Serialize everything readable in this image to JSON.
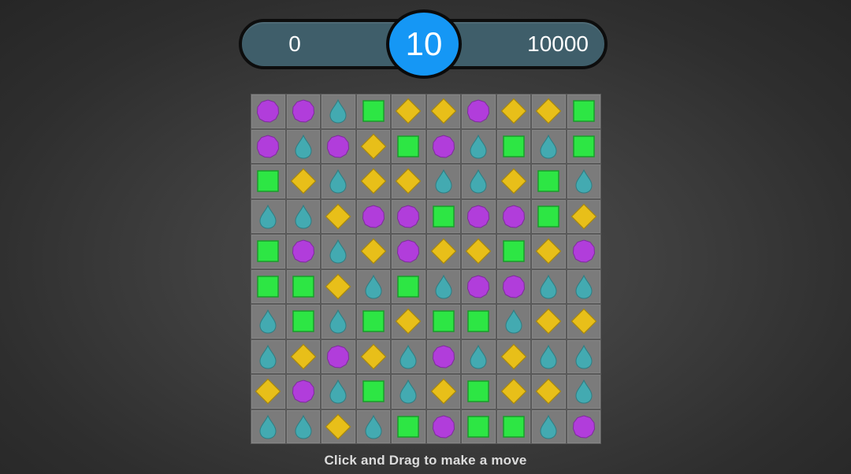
{
  "score_bar": {
    "current_score": "0",
    "moves_left": "10",
    "target_score": "10000"
  },
  "board": {
    "legend": {
      "C": "purple-circle",
      "D": "teal-drop",
      "S": "green-square",
      "Y": "yellow-diamond"
    },
    "colors": {
      "purple": "#b13ddb",
      "teal": "#43aab1",
      "green": "#2de644",
      "yellow": "#e8bf19"
    },
    "rows": [
      "CCDSYYCYYS",
      "CDCYSCDSDS",
      "SYDYYDDYSD",
      "DDYCCSCCSY",
      "SCDYCYYSYC",
      "SSYDSDCCDD",
      "DSDSYSSDYY",
      "DYCYDCDYDD",
      "YCDSDYSYYD",
      "DDYDSCSSDC"
    ]
  },
  "hint_text": "Click and Drag to make a move"
}
